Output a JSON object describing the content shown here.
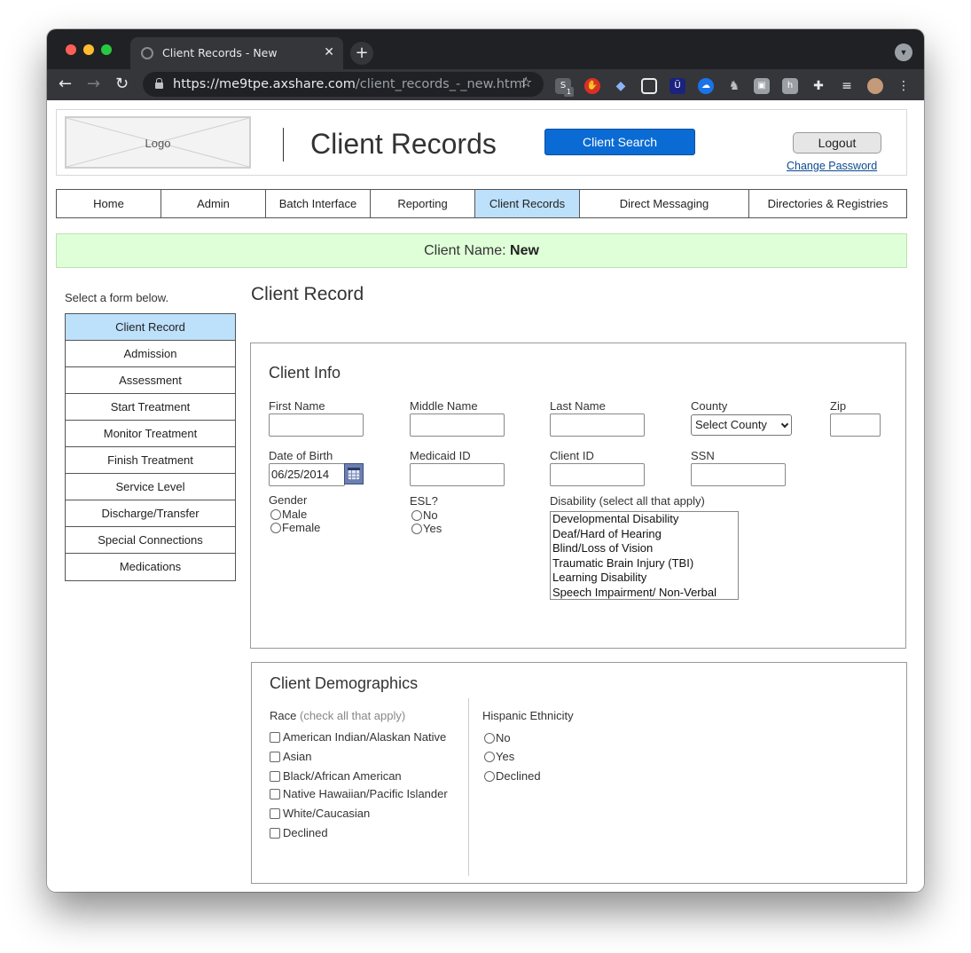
{
  "browser": {
    "tab_title": "Client Records - New",
    "url_host": "https://me9tpe.axshare.com",
    "url_path": "/client_records_-_new.html",
    "new_tab_glyph": "+",
    "close_glyph": "✕",
    "ext_badge_count": "1",
    "ext_letters": [
      "S",
      "Ü",
      "h"
    ],
    "extension_icons": [
      "s-icon",
      "stop-hand-icon",
      "diamond-icon",
      "screenshot-icon",
      "u-icon",
      "cloud-icon",
      "puppy-icon",
      "image-icon",
      "h-icon",
      "puzzle-icon",
      "playlist-icon",
      "avatar-icon",
      "kebab-menu-icon"
    ]
  },
  "header": {
    "logo_text": "Logo",
    "app_title": "Client Records",
    "search_button": "Client Search",
    "logout_button": "Logout",
    "change_password_link": "Change Password"
  },
  "main_nav": {
    "items": [
      {
        "label": "Home"
      },
      {
        "label": "Admin"
      },
      {
        "label": "Batch Interface"
      },
      {
        "label": "Reporting"
      },
      {
        "label": "Client Records"
      },
      {
        "label": "Direct Messaging"
      },
      {
        "label": "Directories & Registries"
      }
    ],
    "active": "Client Records"
  },
  "banner": {
    "label": "Client Name:",
    "value": "New"
  },
  "sidebar": {
    "hint": "Select a form below.",
    "items": [
      {
        "label": "Client Record"
      },
      {
        "label": "Admission"
      },
      {
        "label": "Assessment"
      },
      {
        "label": "Start Treatment"
      },
      {
        "label": "Monitor Treatment"
      },
      {
        "label": "Finish Treatment"
      },
      {
        "label": "Service Level"
      },
      {
        "label": "Discharge/Transfer"
      },
      {
        "label": "Special Connections"
      },
      {
        "label": "Medications"
      }
    ],
    "active": "Client Record"
  },
  "content": {
    "title": "Client Record",
    "client_info": {
      "title": "Client Info",
      "first_name_label": "First Name",
      "first_name_value": "",
      "middle_name_label": "Middle Name",
      "middle_name_value": "",
      "last_name_label": "Last Name",
      "last_name_value": "",
      "county_label": "County",
      "county_value": "Select County",
      "zip_label": "Zip",
      "zip_value": "",
      "dob_label": "Date of Birth",
      "dob_value": "06/25/2014",
      "medicaid_label": "Medicaid ID",
      "medicaid_value": "",
      "client_id_label": "Client ID",
      "client_id_value": "",
      "ssn_label": "SSN",
      "ssn_value": "",
      "gender_label": "Gender",
      "gender_options": [
        "Male",
        "Female"
      ],
      "esl_label": "ESL?",
      "esl_options": [
        "No",
        "Yes"
      ],
      "disability_label": "Disability (select all that apply)",
      "disability_options": [
        "Developmental Disability",
        "Deaf/Hard of Hearing",
        "Blind/Loss of Vision",
        "Traumatic Brain Injury (TBI)",
        "Learning Disability",
        "Speech Impairment/ Non-Verbal"
      ]
    },
    "demographics": {
      "title": "Client Demographics",
      "race_label": "Race",
      "race_hint": "(check all that apply)",
      "race_options": [
        "American Indian/Alaskan Native",
        "Asian",
        "Black/African American",
        "Native Hawaiian/Pacific Islander",
        "White/Caucasian",
        "Declined"
      ],
      "ethnicity_label": "Hispanic Ethnicity",
      "ethnicity_options": [
        "No",
        "Yes",
        "Declined"
      ]
    }
  }
}
